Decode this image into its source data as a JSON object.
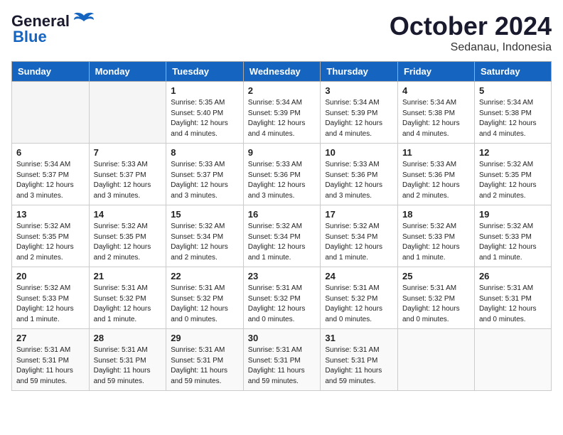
{
  "logo": {
    "line1": "General",
    "line2": "Blue"
  },
  "header": {
    "month": "October 2024",
    "location": "Sedanau, Indonesia"
  },
  "weekdays": [
    "Sunday",
    "Monday",
    "Tuesday",
    "Wednesday",
    "Thursday",
    "Friday",
    "Saturday"
  ],
  "weeks": [
    [
      {
        "day": "",
        "info": ""
      },
      {
        "day": "",
        "info": ""
      },
      {
        "day": "1",
        "info": "Sunrise: 5:35 AM\nSunset: 5:40 PM\nDaylight: 12 hours and 4 minutes."
      },
      {
        "day": "2",
        "info": "Sunrise: 5:34 AM\nSunset: 5:39 PM\nDaylight: 12 hours and 4 minutes."
      },
      {
        "day": "3",
        "info": "Sunrise: 5:34 AM\nSunset: 5:39 PM\nDaylight: 12 hours and 4 minutes."
      },
      {
        "day": "4",
        "info": "Sunrise: 5:34 AM\nSunset: 5:38 PM\nDaylight: 12 hours and 4 minutes."
      },
      {
        "day": "5",
        "info": "Sunrise: 5:34 AM\nSunset: 5:38 PM\nDaylight: 12 hours and 4 minutes."
      }
    ],
    [
      {
        "day": "6",
        "info": "Sunrise: 5:34 AM\nSunset: 5:37 PM\nDaylight: 12 hours and 3 minutes."
      },
      {
        "day": "7",
        "info": "Sunrise: 5:33 AM\nSunset: 5:37 PM\nDaylight: 12 hours and 3 minutes."
      },
      {
        "day": "8",
        "info": "Sunrise: 5:33 AM\nSunset: 5:37 PM\nDaylight: 12 hours and 3 minutes."
      },
      {
        "day": "9",
        "info": "Sunrise: 5:33 AM\nSunset: 5:36 PM\nDaylight: 12 hours and 3 minutes."
      },
      {
        "day": "10",
        "info": "Sunrise: 5:33 AM\nSunset: 5:36 PM\nDaylight: 12 hours and 3 minutes."
      },
      {
        "day": "11",
        "info": "Sunrise: 5:33 AM\nSunset: 5:36 PM\nDaylight: 12 hours and 2 minutes."
      },
      {
        "day": "12",
        "info": "Sunrise: 5:32 AM\nSunset: 5:35 PM\nDaylight: 12 hours and 2 minutes."
      }
    ],
    [
      {
        "day": "13",
        "info": "Sunrise: 5:32 AM\nSunset: 5:35 PM\nDaylight: 12 hours and 2 minutes."
      },
      {
        "day": "14",
        "info": "Sunrise: 5:32 AM\nSunset: 5:35 PM\nDaylight: 12 hours and 2 minutes."
      },
      {
        "day": "15",
        "info": "Sunrise: 5:32 AM\nSunset: 5:34 PM\nDaylight: 12 hours and 2 minutes."
      },
      {
        "day": "16",
        "info": "Sunrise: 5:32 AM\nSunset: 5:34 PM\nDaylight: 12 hours and 1 minute."
      },
      {
        "day": "17",
        "info": "Sunrise: 5:32 AM\nSunset: 5:34 PM\nDaylight: 12 hours and 1 minute."
      },
      {
        "day": "18",
        "info": "Sunrise: 5:32 AM\nSunset: 5:33 PM\nDaylight: 12 hours and 1 minute."
      },
      {
        "day": "19",
        "info": "Sunrise: 5:32 AM\nSunset: 5:33 PM\nDaylight: 12 hours and 1 minute."
      }
    ],
    [
      {
        "day": "20",
        "info": "Sunrise: 5:32 AM\nSunset: 5:33 PM\nDaylight: 12 hours and 1 minute."
      },
      {
        "day": "21",
        "info": "Sunrise: 5:31 AM\nSunset: 5:32 PM\nDaylight: 12 hours and 1 minute."
      },
      {
        "day": "22",
        "info": "Sunrise: 5:31 AM\nSunset: 5:32 PM\nDaylight: 12 hours and 0 minutes."
      },
      {
        "day": "23",
        "info": "Sunrise: 5:31 AM\nSunset: 5:32 PM\nDaylight: 12 hours and 0 minutes."
      },
      {
        "day": "24",
        "info": "Sunrise: 5:31 AM\nSunset: 5:32 PM\nDaylight: 12 hours and 0 minutes."
      },
      {
        "day": "25",
        "info": "Sunrise: 5:31 AM\nSunset: 5:32 PM\nDaylight: 12 hours and 0 minutes."
      },
      {
        "day": "26",
        "info": "Sunrise: 5:31 AM\nSunset: 5:31 PM\nDaylight: 12 hours and 0 minutes."
      }
    ],
    [
      {
        "day": "27",
        "info": "Sunrise: 5:31 AM\nSunset: 5:31 PM\nDaylight: 11 hours and 59 minutes."
      },
      {
        "day": "28",
        "info": "Sunrise: 5:31 AM\nSunset: 5:31 PM\nDaylight: 11 hours and 59 minutes."
      },
      {
        "day": "29",
        "info": "Sunrise: 5:31 AM\nSunset: 5:31 PM\nDaylight: 11 hours and 59 minutes."
      },
      {
        "day": "30",
        "info": "Sunrise: 5:31 AM\nSunset: 5:31 PM\nDaylight: 11 hours and 59 minutes."
      },
      {
        "day": "31",
        "info": "Sunrise: 5:31 AM\nSunset: 5:31 PM\nDaylight: 11 hours and 59 minutes."
      },
      {
        "day": "",
        "info": ""
      },
      {
        "day": "",
        "info": ""
      }
    ]
  ]
}
